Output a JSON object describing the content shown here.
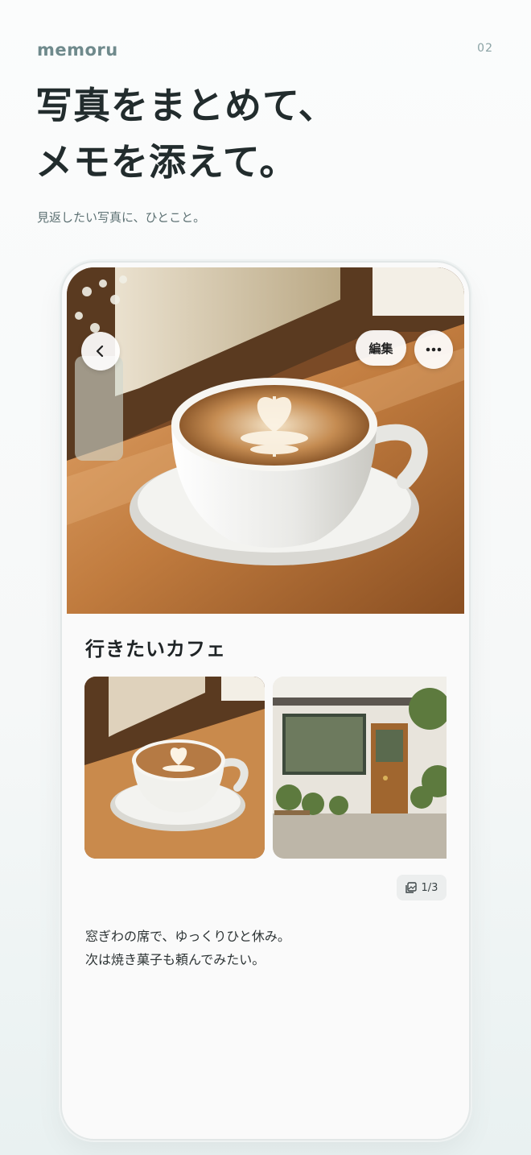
{
  "brand": "memoru",
  "page_number": "02",
  "headline": {
    "line1": "写真をまとめて、",
    "line2": "メモを添えて。"
  },
  "subhead": "見返したい写真に、ひとこと。",
  "phone": {
    "toolbar": {
      "back_icon": "chevron-left-icon",
      "edit_label": "編集",
      "more_icon": "more-horizontal-icon"
    },
    "album_title": "行きたいカフェ",
    "photo_counter": "1/3",
    "memo": {
      "line1": "窓ぎわの席で、ゆっくりひと休み。",
      "line2": "次は焼き菓子も頼んでみたい。"
    }
  }
}
